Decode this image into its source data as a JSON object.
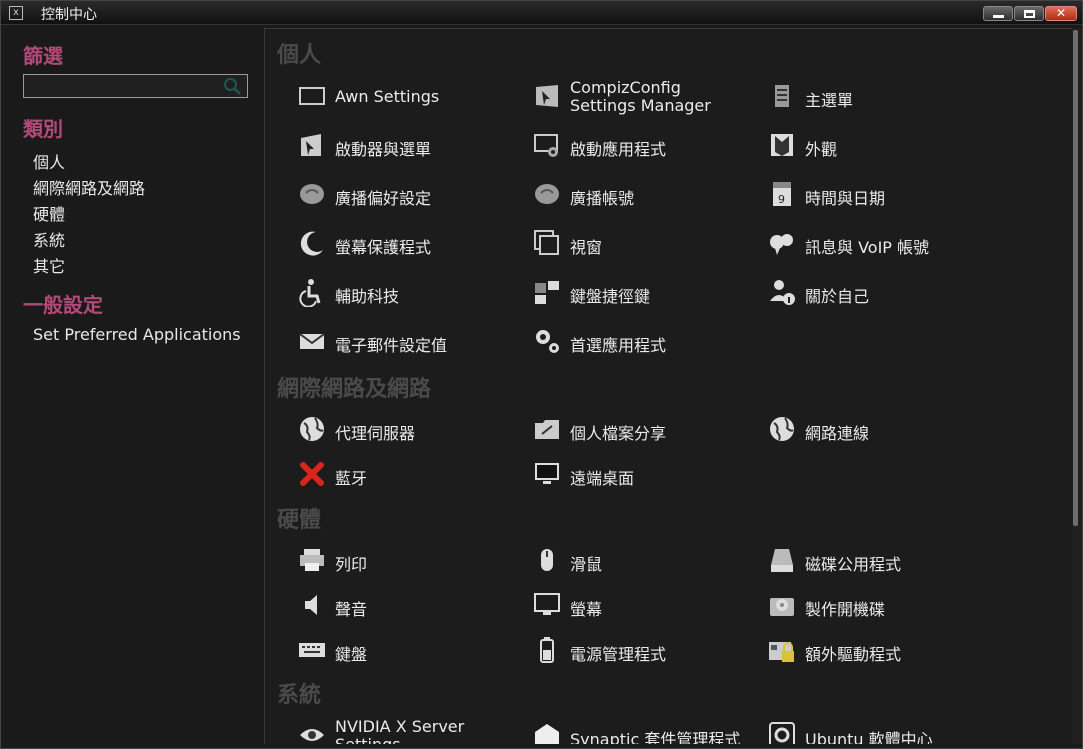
{
  "window": {
    "title": "控制中心",
    "close_glyph": "x"
  },
  "sidebar": {
    "filter_heading": "篩選",
    "search": {
      "value": "",
      "placeholder": ""
    },
    "category_heading": "類別",
    "categories": [
      "個人",
      "網際網路及網路",
      "硬體",
      "系統",
      "其它"
    ],
    "general_heading": "一般設定",
    "general_items": [
      "Set Preferred Applications"
    ]
  },
  "main": {
    "sections": [
      {
        "title": "個人",
        "items": [
          {
            "label": "Awn Settings",
            "icon": "awn-icon"
          },
          {
            "label": "CompizConfig\nSettings Manager",
            "icon": "compiz-icon"
          },
          {
            "label": "主選單",
            "icon": "menu-icon"
          },
          {
            "label": "啟動器與選單",
            "icon": "launcher-icon"
          },
          {
            "label": "啟動應用程式",
            "icon": "startup-apps-icon"
          },
          {
            "label": "外觀",
            "icon": "appearance-icon"
          },
          {
            "label": "廣播偏好設定",
            "icon": "broadcast-prefs-icon"
          },
          {
            "label": "廣播帳號",
            "icon": "broadcast-accounts-icon"
          },
          {
            "label": "時間與日期",
            "icon": "calendar-icon"
          },
          {
            "label": "螢幕保護程式",
            "icon": "moon-icon"
          },
          {
            "label": "視窗",
            "icon": "windows-icon"
          },
          {
            "label": "訊息與 VoIP 帳號",
            "icon": "chat-icon"
          },
          {
            "label": "輔助科技",
            "icon": "accessibility-icon"
          },
          {
            "label": "鍵盤捷徑鍵",
            "icon": "shortcuts-icon"
          },
          {
            "label": "關於自己",
            "icon": "about-me-icon"
          },
          {
            "label": "電子郵件設定值",
            "icon": "mail-icon"
          },
          {
            "label": "首選應用程式",
            "icon": "gears-icon"
          }
        ]
      },
      {
        "title": "網際網路及網路",
        "items": [
          {
            "label": "代理伺服器",
            "icon": "proxy-globe-icon"
          },
          {
            "label": "個人檔案分享",
            "icon": "file-share-icon"
          },
          {
            "label": "網路連線",
            "icon": "network-globe-icon"
          },
          {
            "label": "藍牙",
            "icon": "bluetooth-x-icon"
          },
          {
            "label": "遠端桌面",
            "icon": "remote-desktop-icon"
          }
        ]
      },
      {
        "title": "硬體",
        "items": [
          {
            "label": "列印",
            "icon": "printer-icon"
          },
          {
            "label": "滑鼠",
            "icon": "mouse-icon"
          },
          {
            "label": "磁碟公用程式",
            "icon": "disk-icon"
          },
          {
            "label": "聲音",
            "icon": "speaker-icon"
          },
          {
            "label": "螢幕",
            "icon": "monitor-icon"
          },
          {
            "label": "製作開機碟",
            "icon": "startup-disk-icon"
          },
          {
            "label": "鍵盤",
            "icon": "keyboard-icon"
          },
          {
            "label": "電源管理程式",
            "icon": "battery-icon"
          },
          {
            "label": "額外驅動程式",
            "icon": "drivers-icon"
          }
        ]
      },
      {
        "title": "系統",
        "items": [
          {
            "label": "NVIDIA X Server\nSettings",
            "icon": "nvidia-icon"
          },
          {
            "label": "Synaptic 套件管理程式",
            "icon": "synaptic-icon"
          },
          {
            "label": "Ubuntu 軟體中心",
            "icon": "software-center-icon"
          }
        ]
      }
    ]
  }
}
